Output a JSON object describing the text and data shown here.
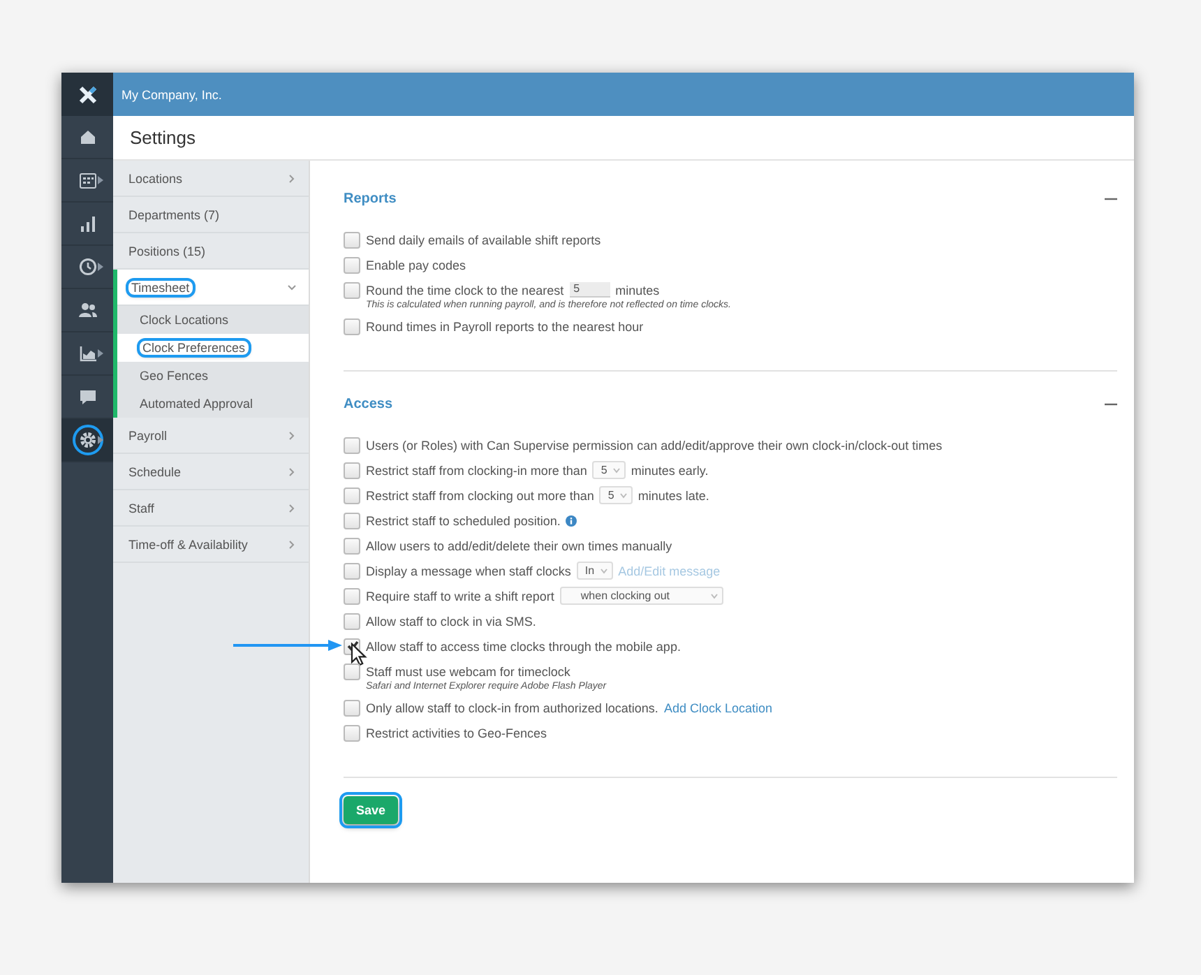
{
  "app": {
    "company": "My Company, Inc.",
    "page_title": "Settings"
  },
  "rail": [
    {
      "kind": "home",
      "submenu": false,
      "selected": false,
      "highlighted": false
    },
    {
      "kind": "calendar",
      "submenu": true,
      "selected": false,
      "highlighted": false
    },
    {
      "kind": "bars",
      "submenu": false,
      "selected": false,
      "highlighted": false
    },
    {
      "kind": "clock",
      "submenu": true,
      "selected": false,
      "highlighted": false
    },
    {
      "kind": "people",
      "submenu": false,
      "selected": false,
      "highlighted": false
    },
    {
      "kind": "area",
      "submenu": true,
      "selected": false,
      "highlighted": false
    },
    {
      "kind": "chat",
      "submenu": false,
      "selected": false,
      "highlighted": false
    },
    {
      "kind": "gear",
      "submenu": true,
      "selected": true,
      "highlighted": true
    }
  ],
  "nav": [
    {
      "label": "Locations",
      "kind": "group",
      "expanded": false,
      "highlighted": false
    },
    {
      "label": "Departments (7)",
      "kind": "link",
      "highlighted": false
    },
    {
      "label": "Positions (15)",
      "kind": "link",
      "highlighted": false
    },
    {
      "label": "Timesheet",
      "kind": "group",
      "expanded": true,
      "highlighted": true,
      "children": [
        {
          "label": "Clock Locations",
          "selected": false,
          "highlighted": false
        },
        {
          "label": "Clock Preferences",
          "selected": true,
          "highlighted": true
        },
        {
          "label": "Geo Fences",
          "selected": false,
          "highlighted": false
        },
        {
          "label": "Automated Approval",
          "selected": false,
          "highlighted": false
        }
      ]
    },
    {
      "label": "Payroll",
      "kind": "group",
      "expanded": false,
      "highlighted": false
    },
    {
      "label": "Schedule",
      "kind": "group",
      "expanded": false,
      "highlighted": false
    },
    {
      "label": "Staff",
      "kind": "group",
      "expanded": false,
      "highlighted": false
    },
    {
      "label": "Time-off & Availability",
      "kind": "group",
      "expanded": false,
      "highlighted": false
    }
  ],
  "sections": [
    {
      "title": "Reports",
      "expanded": true,
      "options": [
        {
          "checked": false,
          "annotated": false,
          "parts": [
            {
              "kind": "text",
              "text": "Send daily emails of available shift reports"
            }
          ]
        },
        {
          "checked": false,
          "annotated": false,
          "parts": [
            {
              "kind": "text",
              "text": "Enable pay codes"
            }
          ]
        },
        {
          "checked": false,
          "annotated": false,
          "parts": [
            {
              "kind": "text",
              "text": "Round the time clock to the nearest"
            },
            {
              "kind": "input",
              "value": "5"
            },
            {
              "kind": "text",
              "text": "minutes"
            }
          ],
          "note": "This is calculated when running payroll, and is therefore not reflected on time clocks."
        },
        {
          "checked": false,
          "annotated": false,
          "parts": [
            {
              "kind": "text",
              "text": "Round times in Payroll reports to the nearest hour"
            }
          ]
        }
      ]
    },
    {
      "title": "Access",
      "expanded": true,
      "options": [
        {
          "checked": false,
          "annotated": false,
          "parts": [
            {
              "kind": "text",
              "text": "Users (or Roles) with Can Supervise permission can add/edit/approve their own clock-in/clock-out times"
            }
          ]
        },
        {
          "checked": false,
          "annotated": false,
          "parts": [
            {
              "kind": "text",
              "text": "Restrict staff from clocking-in more than"
            },
            {
              "kind": "select",
              "value": "5"
            },
            {
              "kind": "text",
              "text": "minutes early."
            }
          ]
        },
        {
          "checked": false,
          "annotated": false,
          "parts": [
            {
              "kind": "text",
              "text": "Restrict staff from clocking out more than"
            },
            {
              "kind": "select",
              "value": "5"
            },
            {
              "kind": "text",
              "text": "minutes late."
            }
          ]
        },
        {
          "checked": false,
          "annotated": false,
          "parts": [
            {
              "kind": "text",
              "text": "Restrict staff to scheduled position."
            },
            {
              "kind": "info"
            }
          ]
        },
        {
          "checked": false,
          "annotated": false,
          "parts": [
            {
              "kind": "text",
              "text": "Allow users to add/edit/delete their own times manually"
            }
          ]
        },
        {
          "checked": false,
          "annotated": false,
          "parts": [
            {
              "kind": "text",
              "text": "Display a message when staff clocks"
            },
            {
              "kind": "select",
              "value": "In"
            },
            {
              "kind": "link",
              "text": "Add/Edit message",
              "disabled": true
            }
          ]
        },
        {
          "checked": false,
          "annotated": false,
          "parts": [
            {
              "kind": "text",
              "text": "Require staff to write a shift report"
            },
            {
              "kind": "wideselect",
              "value": "when clocking out"
            }
          ]
        },
        {
          "checked": false,
          "annotated": false,
          "parts": [
            {
              "kind": "text",
              "text": "Allow staff to clock in via SMS."
            }
          ]
        },
        {
          "checked": true,
          "annotated": true,
          "parts": [
            {
              "kind": "text",
              "text": "Allow staff to access time clocks through the mobile app."
            }
          ]
        },
        {
          "checked": false,
          "annotated": false,
          "parts": [
            {
              "kind": "text",
              "text": "Staff must use webcam for timeclock"
            }
          ],
          "note": "Safari and Internet Explorer require Adobe Flash Player"
        },
        {
          "checked": false,
          "annotated": false,
          "parts": [
            {
              "kind": "text",
              "text": "Only allow staff to clock-in from authorized locations."
            },
            {
              "kind": "link",
              "text": "Add Clock Location",
              "disabled": false
            }
          ]
        },
        {
          "checked": false,
          "annotated": false,
          "parts": [
            {
              "kind": "text",
              "text": "Restrict activities to Geo-Fences"
            }
          ]
        }
      ]
    }
  ],
  "save": {
    "label": "Save",
    "highlighted": true
  }
}
